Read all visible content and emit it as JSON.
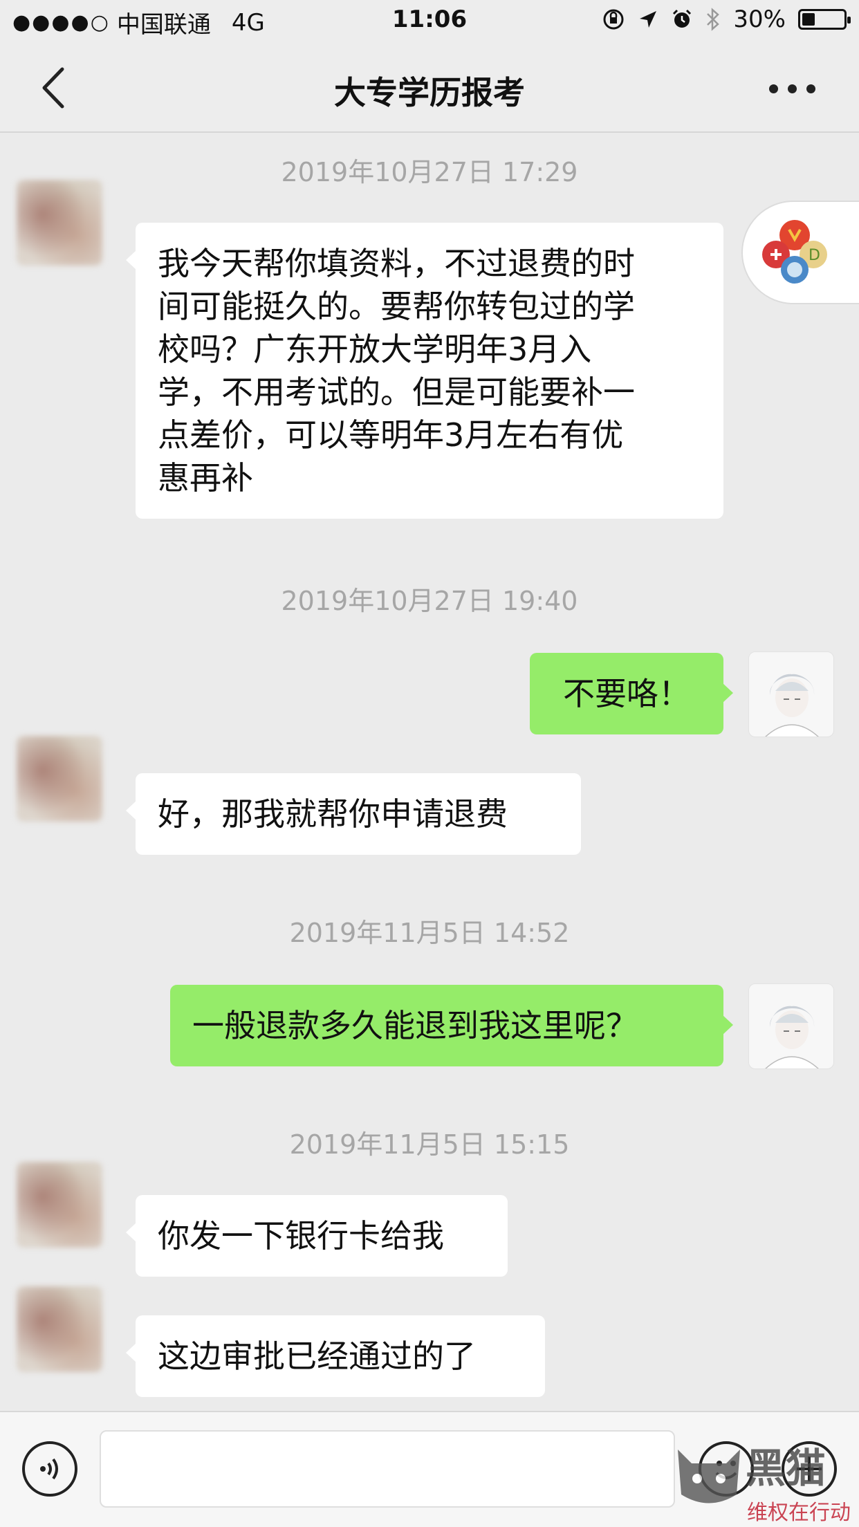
{
  "status_bar": {
    "signal": "●●●●○",
    "carrier": "中国联通",
    "network": "4G",
    "time": "11:06",
    "battery": "30%",
    "battery_level": 0.3
  },
  "nav": {
    "title": "大专学历报考",
    "back_icon": "chevron-left-icon",
    "more_icon": "more-dots-icon"
  },
  "messages": [
    {
      "type": "timestamp",
      "text": "2019年10月27日 17:29"
    },
    {
      "type": "in",
      "lines": [
        "我今天帮你填资料，不过退费的时",
        "间可能挺久的。要帮你转包过的学",
        "校吗？广东开放大学明年3月入",
        "学，不用考试的。但是可能要补一",
        "点差价，可以等明年3月左右有优",
        "惠再补"
      ]
    },
    {
      "type": "timestamp",
      "text": "2019年10月27日 19:40"
    },
    {
      "type": "out",
      "text": "不要咯！"
    },
    {
      "type": "in",
      "text": "好，那我就帮你申请退费"
    },
    {
      "type": "timestamp",
      "text": "2019年11月5日 14:52"
    },
    {
      "type": "out",
      "text": "一般退款多久能退到我这里呢？"
    },
    {
      "type": "timestamp",
      "text": "2019年11月5日 15:15"
    },
    {
      "type": "in",
      "text": "你发一下银行卡给我"
    },
    {
      "type": "in",
      "text": "这边审批已经通过的了"
    }
  ],
  "input_bar": {
    "voice_icon": "voice-icon",
    "emoji_icon": "emoji-icon",
    "plus_icon": "plus-icon"
  },
  "watermark": {
    "text": "黑猫",
    "sub": "维权在行动"
  },
  "colors": {
    "outgoing_bubble": "#95ec69",
    "incoming_bubble": "#ffffff",
    "background": "#ebebeb"
  }
}
